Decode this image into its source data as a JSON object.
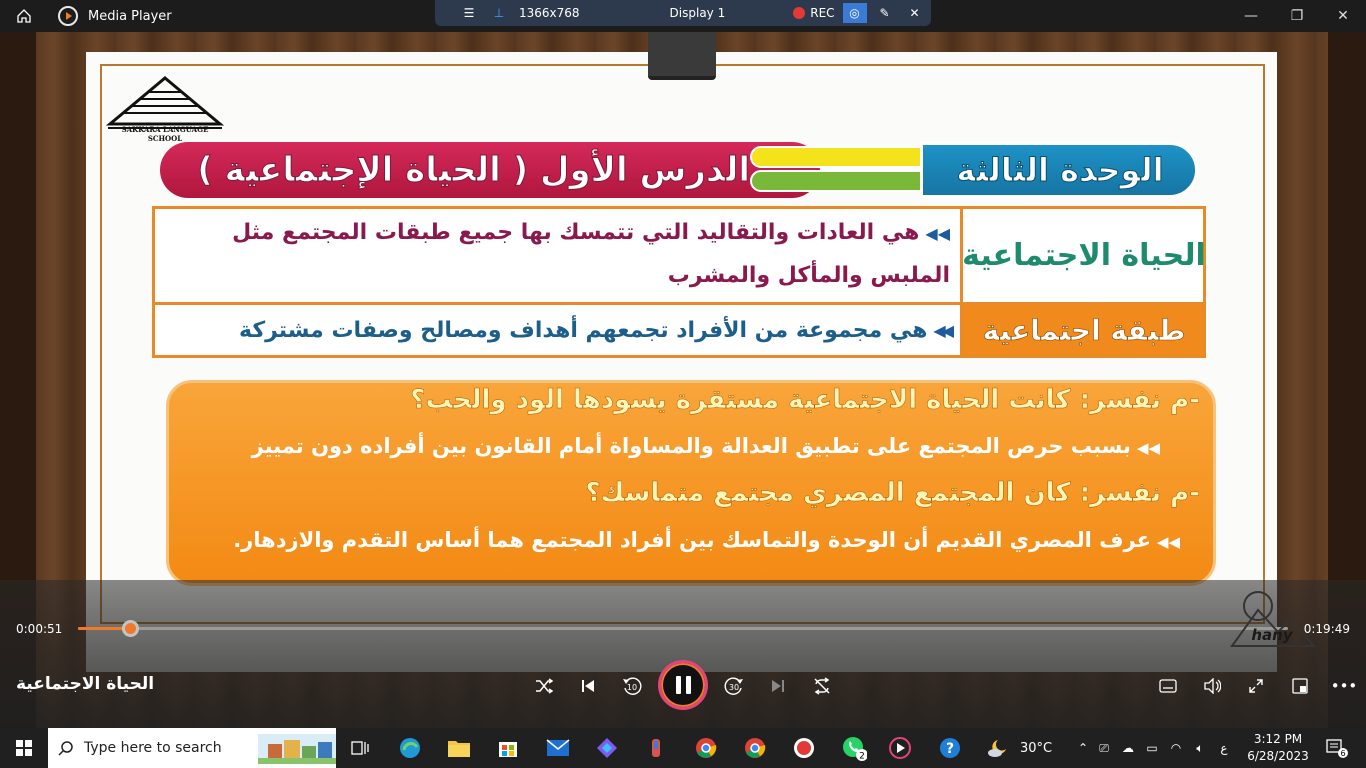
{
  "window": {
    "title": "Media Player",
    "minimize": "—",
    "maximize": "❐",
    "close": "✕"
  },
  "display_toolbar": {
    "resolution": "1366x768",
    "display": "Display 1",
    "rec": "REC"
  },
  "slide": {
    "school_name": "SAKKARA LANGUAGE SCHOOL",
    "unit_title": "الوحدة الثالثة",
    "lesson_title": "الدرس الأول ( الحياة الإجتماعية )",
    "rows": [
      {
        "term": "الحياة الاجتماعية",
        "definition": "هي العادات والتقاليد التي تتمسك بها جميع طبقات المجتمع مثل الملبس والمأكل والمشرب"
      },
      {
        "term": "طبقة اجتماعية",
        "definition": "هي مجموعة من الأفراد تجمعهم أهداف ومصالح وصفات مشتركة"
      }
    ],
    "qa": [
      {
        "question": "-م نفسر: كانت الحياة الاجتماعية مستقرة يسودها الود والحب؟",
        "answer": "بسبب حرص المجتمع على تطبيق العدالة والمساواة أمام القانون بين أفراده دون تمييز"
      },
      {
        "question": "-م نفسر: كان المجتمع المصري مجتمع متماسك؟",
        "answer": "عرف المصري القديم أن الوحدة والتماسك بين أفراد المجتمع هما أساس التقدم والازدهار."
      }
    ],
    "watermark": "hany",
    "colors": {
      "unit_banner": "#1e92c6",
      "lesson_banner": "#c8204d",
      "table_border": "#e88a27",
      "qa_box": "#f5961f"
    }
  },
  "player": {
    "current_time": "0:00:51",
    "total_time": "0:19:49",
    "progress_fraction": 0.043,
    "media_title": "الحياة الاجتماعية",
    "skip_back_label": "10",
    "skip_forward_label": "30",
    "accent_color": "#f07a2a"
  },
  "taskbar": {
    "search_placeholder": "Type here to search",
    "whatsapp_badge": "2",
    "weather": "30°C",
    "language": "ع",
    "time": "3:12 PM",
    "date": "6/28/2023",
    "notification_count": "6"
  }
}
